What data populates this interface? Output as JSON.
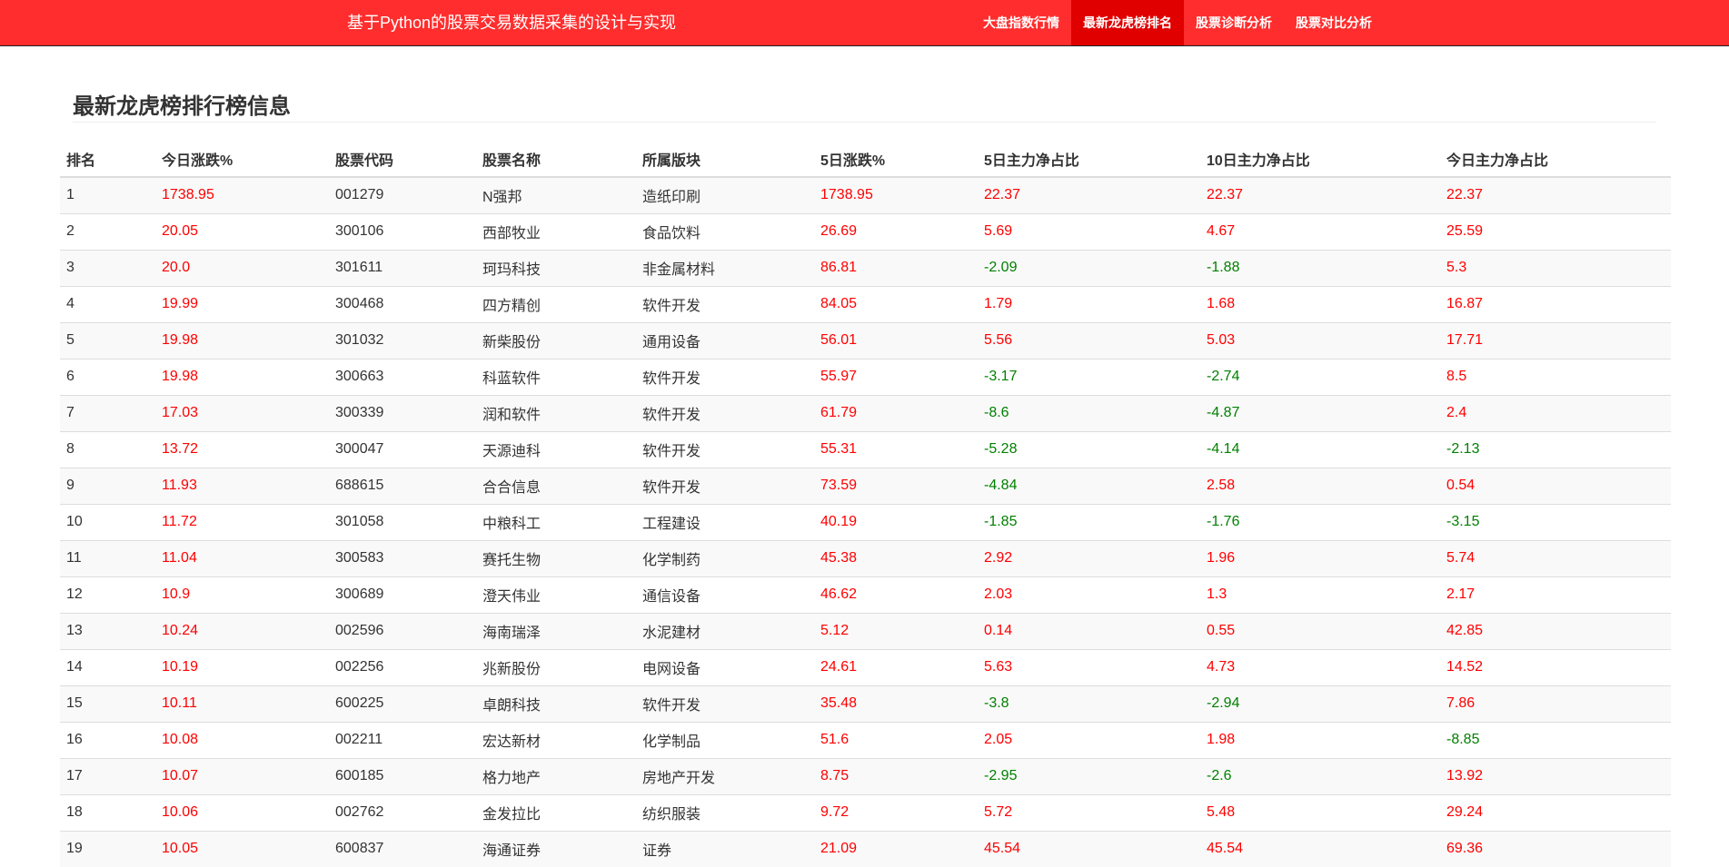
{
  "header": {
    "title": "基于Python的股票交易数据采集的设计与实现",
    "nav": [
      {
        "label": "大盘指数行情",
        "active": false
      },
      {
        "label": "最新龙虎榜排名",
        "active": true
      },
      {
        "label": "股票诊断分析",
        "active": false
      },
      {
        "label": "股票对比分析",
        "active": false
      }
    ]
  },
  "main": {
    "heading": "最新龙虎榜排行榜信息",
    "colors": {
      "up": "#ff0000",
      "down": "#008000"
    },
    "columns": [
      "排名",
      "今日涨跌%",
      "股票代码",
      "股票名称",
      "所属版块",
      "5日涨跌%",
      "5日主力净占比",
      "10日主力净占比",
      "今日主力净占比"
    ],
    "rows": [
      [
        "1",
        "1738.95",
        "001279",
        "N强邦",
        "造纸印刷",
        "1738.95",
        "22.37",
        "22.37",
        "22.37"
      ],
      [
        "2",
        "20.05",
        "300106",
        "西部牧业",
        "食品饮料",
        "26.69",
        "5.69",
        "4.67",
        "25.59"
      ],
      [
        "3",
        "20.0",
        "301611",
        "珂玛科技",
        "非金属材料",
        "86.81",
        "-2.09",
        "-1.88",
        "5.3"
      ],
      [
        "4",
        "19.99",
        "300468",
        "四方精创",
        "软件开发",
        "84.05",
        "1.79",
        "1.68",
        "16.87"
      ],
      [
        "5",
        "19.98",
        "301032",
        "新柴股份",
        "通用设备",
        "56.01",
        "5.56",
        "5.03",
        "17.71"
      ],
      [
        "6",
        "19.98",
        "300663",
        "科蓝软件",
        "软件开发",
        "55.97",
        "-3.17",
        "-2.74",
        "8.5"
      ],
      [
        "7",
        "17.03",
        "300339",
        "润和软件",
        "软件开发",
        "61.79",
        "-8.6",
        "-4.87",
        "2.4"
      ],
      [
        "8",
        "13.72",
        "300047",
        "天源迪科",
        "软件开发",
        "55.31",
        "-5.28",
        "-4.14",
        "-2.13"
      ],
      [
        "9",
        "11.93",
        "688615",
        "合合信息",
        "软件开发",
        "73.59",
        "-4.84",
        "2.58",
        "0.54"
      ],
      [
        "10",
        "11.72",
        "301058",
        "中粮科工",
        "工程建设",
        "40.19",
        "-1.85",
        "-1.76",
        "-3.15"
      ],
      [
        "11",
        "11.04",
        "300583",
        "赛托生物",
        "化学制药",
        "45.38",
        "2.92",
        "1.96",
        "5.74"
      ],
      [
        "12",
        "10.9",
        "300689",
        "澄天伟业",
        "通信设备",
        "46.62",
        "2.03",
        "1.3",
        "2.17"
      ],
      [
        "13",
        "10.24",
        "002596",
        "海南瑞泽",
        "水泥建材",
        "5.12",
        "0.14",
        "0.55",
        "42.85"
      ],
      [
        "14",
        "10.19",
        "002256",
        "兆新股份",
        "电网设备",
        "24.61",
        "5.63",
        "4.73",
        "14.52"
      ],
      [
        "15",
        "10.11",
        "600225",
        "卓朗科技",
        "软件开发",
        "35.48",
        "-3.8",
        "-2.94",
        "7.86"
      ],
      [
        "16",
        "10.08",
        "002211",
        "宏达新材",
        "化学制品",
        "51.6",
        "2.05",
        "1.98",
        "-8.85"
      ],
      [
        "17",
        "10.07",
        "600185",
        "格力地产",
        "房地产开发",
        "8.75",
        "-2.95",
        "-2.6",
        "13.92"
      ],
      [
        "18",
        "10.06",
        "002762",
        "金发拉比",
        "纺织服装",
        "9.72",
        "5.72",
        "5.48",
        "29.24"
      ],
      [
        "19",
        "10.05",
        "600837",
        "海通证券",
        "证券",
        "21.09",
        "45.54",
        "45.54",
        "69.36"
      ]
    ]
  }
}
